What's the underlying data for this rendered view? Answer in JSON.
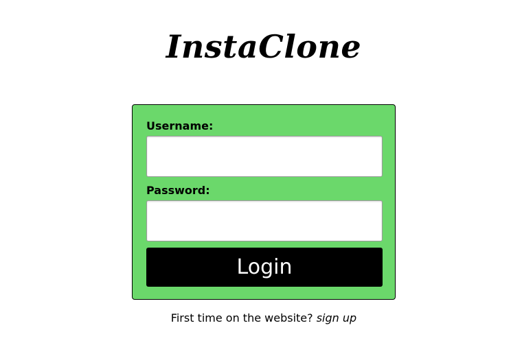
{
  "header": {
    "title": "InstaClone"
  },
  "login_form": {
    "username_label": "Username:",
    "username_value": "",
    "password_label": "Password:",
    "password_value": "",
    "login_button_label": "Login",
    "card_color": "#6bd86b",
    "button_color": "#000000"
  },
  "footer": {
    "prompt_text": "First time on the website?",
    "signup_link_label": "sign up"
  }
}
